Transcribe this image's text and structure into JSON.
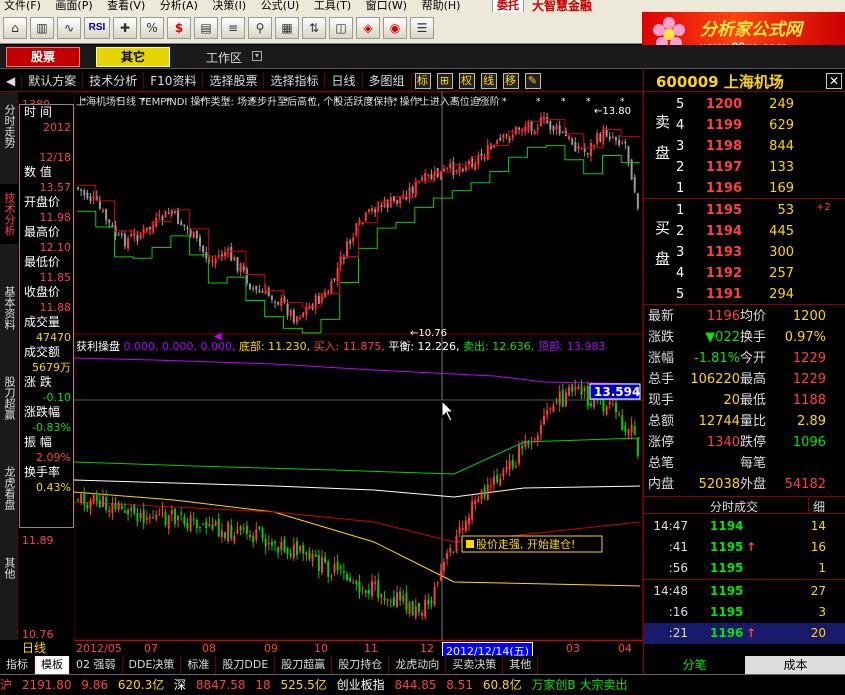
{
  "menu": [
    "文件(F)",
    "画面(P)",
    "查看(V)",
    "分析(A)",
    "决策(I)",
    "公式(U)",
    "工具(T)",
    "窗口(W)",
    "帮助(H)"
  ],
  "menu_right": {
    "trade": "委托",
    "brand": "大智慧金融"
  },
  "logo": {
    "title": "分析家公式网",
    "url": "www.88gs.com"
  },
  "toolbar_icons": [
    "home-icon",
    "kline-icon",
    "minute-chart-icon",
    "rsi-icon",
    "compass-icon",
    "dividend-icon",
    "trade-dollar-icon",
    "quote-list-icon",
    "news-icon",
    "search-binoculars-icon",
    "data-icon",
    "sort-icon",
    "f10-icon",
    "shield-icon",
    "coin-icon",
    "settings-icon"
  ],
  "tabs": {
    "stock": "股票",
    "other": "其它",
    "workspace": "工作区"
  },
  "chart_toolbar": [
    "默认方案",
    "技术分析",
    "F10资料",
    "选择股票",
    "选择指标",
    "日线",
    "多图组",
    "标",
    "",
    "权",
    "线",
    "移",
    ""
  ],
  "left_vtabs": [
    "分时走势",
    "技术分析",
    "基本资料",
    "股刀超赢",
    "龙虎看盘",
    "其他"
  ],
  "info_panel": [
    {
      "label": "时 间",
      "value": "2012"
    },
    {
      "label": "",
      "value": "12/18"
    },
    {
      "label": "数 值",
      "value": "13.57"
    },
    {
      "label": "开盘价",
      "value": "11.98"
    },
    {
      "label": "最高价",
      "value": "12.10"
    },
    {
      "label": "最低价",
      "value": "11.85"
    },
    {
      "label": "收盘价",
      "value": "11.88"
    },
    {
      "label": "成交量",
      "value": "47470"
    },
    {
      "label": "成交额",
      "value": "5679万"
    },
    {
      "label": "涨 跌",
      "value": "-0.10"
    },
    {
      "label": "涨跌幅",
      "value": "-0.83%"
    },
    {
      "label": "振 幅",
      "value": "2.09%"
    },
    {
      "label": "换手率",
      "value": "0.43%"
    }
  ],
  "price_axis": {
    "top": "1380",
    "mid": "11.89",
    "bottom": "10.76"
  },
  "main_chart": {
    "title": "上海机场日线 TEMPINDI 操作类型: 场逐步升至后高位, 个股活跃度保持, 操作上进入高位追涨阶",
    "high_label": "13.80",
    "low_label": "10.76"
  },
  "indicator": {
    "name": "获利操盘",
    "vals": "0.000, 0.000, 0.000,",
    "bottom": "底部: 11.230,",
    "buy": "买入: 11.875,",
    "balance": "平衡: 12.226,",
    "sell": "卖出: 12.636,",
    "top": "顶部: 13.983",
    "flag_value": "13.594",
    "callout": "股价走强, 开始建仓!"
  },
  "date_axis": [
    "2012/05",
    "07",
    "08",
    "09",
    "10",
    "11",
    "12",
    "03",
    "04"
  ],
  "date_highlight": "2012/12/14(五)",
  "period": "日线",
  "indicator_tabs": [
    "指标",
    "模板",
    "02 强弱",
    "DDE决策",
    "标准",
    "股刀DDE",
    "股刀超赢",
    "股刀持仓",
    "龙虎动向",
    "买卖决策",
    "其他"
  ],
  "status_bar": {
    "sh": "沪",
    "sh_index": "2191.80",
    "sh_chg": "9.86",
    "sh_amt": "620.3亿",
    "sz": "深",
    "sz_index": "8847.58",
    "sz_chg": "18",
    "sz_amt": "525.5亿",
    "cy_label": "创业板指",
    "cy_index": "844.85",
    "cy_chg": "8.51",
    "cy_amt": "60.8亿",
    "news": "万家创B 大宗卖出"
  },
  "quote": {
    "code_name": "600009 上海机场",
    "sell_side": "卖盘",
    "buy_side": "买盘",
    "asks": [
      {
        "n": "5",
        "p": "1200",
        "v": "249"
      },
      {
        "n": "4",
        "p": "1199",
        "v": "629"
      },
      {
        "n": "3",
        "p": "1198",
        "v": "844"
      },
      {
        "n": "2",
        "p": "1197",
        "v": "133"
      },
      {
        "n": "1",
        "p": "1196",
        "v": "169"
      }
    ],
    "bids": [
      {
        "n": "1",
        "p": "1195",
        "v": "53"
      },
      {
        "n": "2",
        "p": "1194",
        "v": "445"
      },
      {
        "n": "3",
        "p": "1193",
        "v": "300"
      },
      {
        "n": "4",
        "p": "1192",
        "v": "257"
      },
      {
        "n": "5",
        "p": "1191",
        "v": "294"
      }
    ],
    "bid_change": "+2",
    "stats": [
      {
        "l1": "最新",
        "v1": "1196",
        "l2": "均价",
        "v2": "1200"
      },
      {
        "l1": "涨跌",
        "v1": "▼022",
        "l2": "换手",
        "v2": "0.97%"
      },
      {
        "l1": "涨幅",
        "v1": "-1.81%",
        "l2": "今开",
        "v2": "1229"
      },
      {
        "l1": "总手",
        "v1": "106220",
        "l2": "最高",
        "v2": "1229"
      },
      {
        "l1": "现手",
        "v1": "20",
        "l2": "最低",
        "v2": "1188"
      },
      {
        "l1": "总额",
        "v1": "12744",
        "l2": "量比",
        "v2": "2.89"
      },
      {
        "l1": "涨停",
        "v1": "1340",
        "l2": "跌停",
        "v2": "1096"
      },
      {
        "l1": "总笔",
        "v1": "",
        "l2": "每笔",
        "v2": ""
      },
      {
        "l1": "内盘",
        "v1": "52038",
        "l2": "外盘",
        "v2": "54182"
      }
    ],
    "ticks_header": "分时成交",
    "ticks_detail": "细",
    "ticks": [
      {
        "t": "14:47",
        "p": "1194",
        "a": "",
        "v": "14"
      },
      {
        "t": ":41",
        "p": "1195",
        "a": "↑",
        "v": "16"
      },
      {
        "t": ":56",
        "p": "1195",
        "a": "",
        "v": "1"
      },
      {
        "t": "14:48",
        "p": "1195",
        "a": "",
        "v": "27"
      },
      {
        "t": ":16",
        "p": "1195",
        "a": "",
        "v": "3"
      },
      {
        "t": ":21",
        "p": "1196",
        "a": "↑",
        "v": "20"
      }
    ],
    "tabs": [
      "分笔",
      "成本"
    ]
  },
  "colors": {
    "up": "#ff3b3b",
    "down": "#00e600",
    "bg": "#000000",
    "grid": "#800000",
    "accent": "#ffd700"
  }
}
